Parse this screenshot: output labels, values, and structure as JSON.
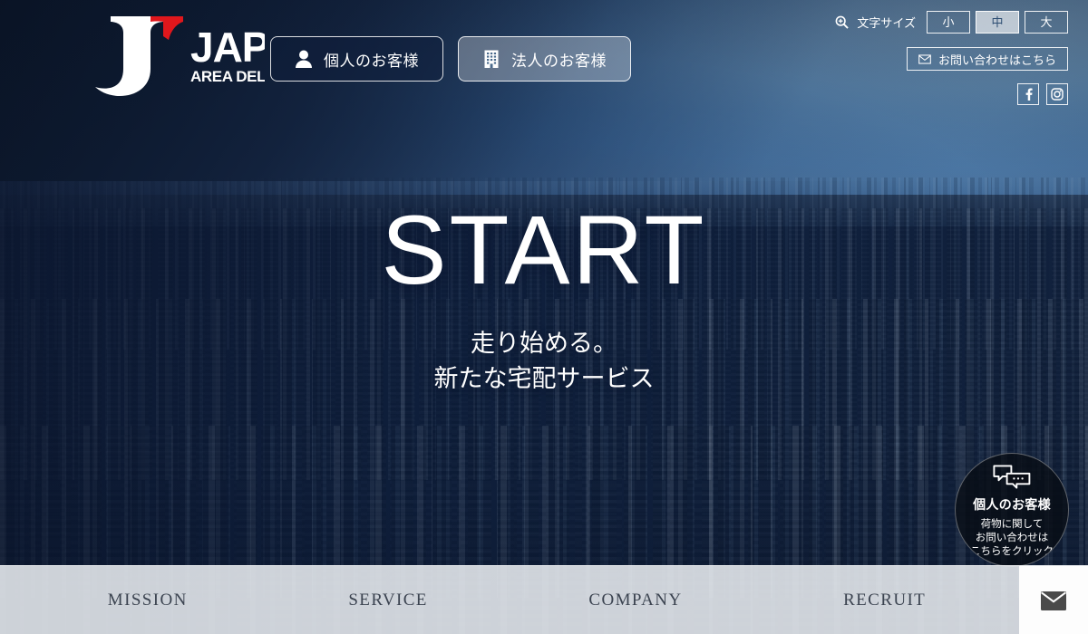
{
  "header": {
    "logo": {
      "name": "JAPAN AREA DELIVERY",
      "main_text": "JAPAN",
      "sub_text": "AREA DELIVERY",
      "mark_color": "#e0171c",
      "text_color": "#ffffff"
    },
    "segment_buttons": [
      {
        "label": "個人のお客様",
        "icon": "person-icon",
        "state": "default"
      },
      {
        "label": "法人のお客様",
        "icon": "building-icon",
        "state": "highlighted"
      }
    ],
    "font_size": {
      "label": "文字サイズ",
      "icon": "magnifier-icon",
      "options": [
        {
          "label": "小",
          "active": false
        },
        {
          "label": "中",
          "active": true
        },
        {
          "label": "大",
          "active": false
        }
      ]
    },
    "contact_button": {
      "label": "お問い合わせはこちら",
      "icon": "envelope-icon"
    },
    "socials": [
      {
        "name": "facebook",
        "icon": "facebook-icon",
        "glyph": "f"
      },
      {
        "name": "instagram",
        "icon": "instagram-icon",
        "glyph": "instagram"
      }
    ]
  },
  "hero": {
    "title": "START",
    "subtitle_line1": "走り始める。",
    "subtitle_line2": "新たな宅配サービス"
  },
  "badge": {
    "icon": "chat-bubbles-icon",
    "title": "個人のお客様",
    "line1": "荷物に関して",
    "line2": "お問い合わせは",
    "line3": "こちらをクリック"
  },
  "bottom_nav": {
    "items": [
      {
        "label": "MISSION"
      },
      {
        "label": "SERVICE"
      },
      {
        "label": "COMPANY"
      },
      {
        "label": "RECRUIT"
      }
    ],
    "mail_button": {
      "icon": "envelope-icon"
    }
  },
  "colors": {
    "brand_red": "#e0171c",
    "dark_navy": "#0d1a33",
    "sky_blue": "#7fb0d6",
    "nav_text": "#3b4350"
  }
}
